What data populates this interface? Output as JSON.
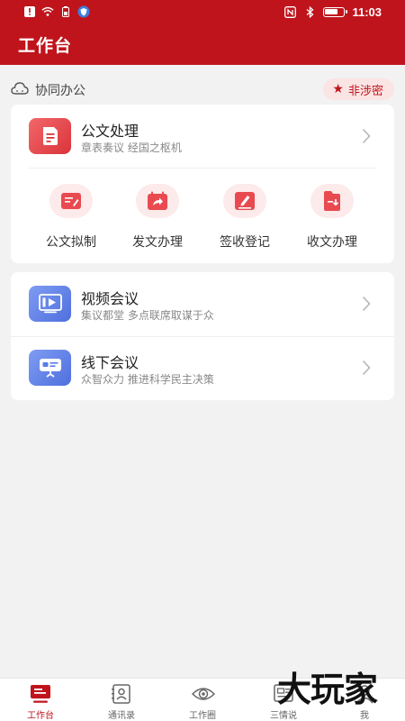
{
  "status_bar": {
    "time": "11:03"
  },
  "header": {
    "title": "工作台"
  },
  "section": {
    "label": "协同办公",
    "badge": "非涉密"
  },
  "document_card": {
    "title": "公文处理",
    "subtitle": "章表奏议 经国之枢机",
    "actions": [
      {
        "label": "公文拟制",
        "icon": "draft-icon"
      },
      {
        "label": "发文办理",
        "icon": "send-doc-icon"
      },
      {
        "label": "签收登记",
        "icon": "sign-icon"
      },
      {
        "label": "收文办理",
        "icon": "receive-doc-icon"
      }
    ]
  },
  "meetings": [
    {
      "title": "视频会议",
      "subtitle": "集议都堂 多点联席取谋于众",
      "icon": "video-icon"
    },
    {
      "title": "线下会议",
      "subtitle": "众智众力 推进科学民主决策",
      "icon": "meeting-icon"
    }
  ],
  "bottom_nav": [
    {
      "label": "工作台",
      "icon": "workbench-icon",
      "active": true
    },
    {
      "label": "通讯录",
      "icon": "contacts-icon",
      "active": false
    },
    {
      "label": "工作圈",
      "icon": "circle-icon",
      "active": false
    },
    {
      "label": "三情说",
      "icon": "news-icon",
      "active": false
    },
    {
      "label": "我",
      "icon": "me-icon",
      "active": false
    }
  ],
  "watermark": "大玩家",
  "colors": {
    "brand_red": "#c0141c",
    "badge_bg": "#fbe4e4",
    "blue_tile": "#5b7be5"
  }
}
